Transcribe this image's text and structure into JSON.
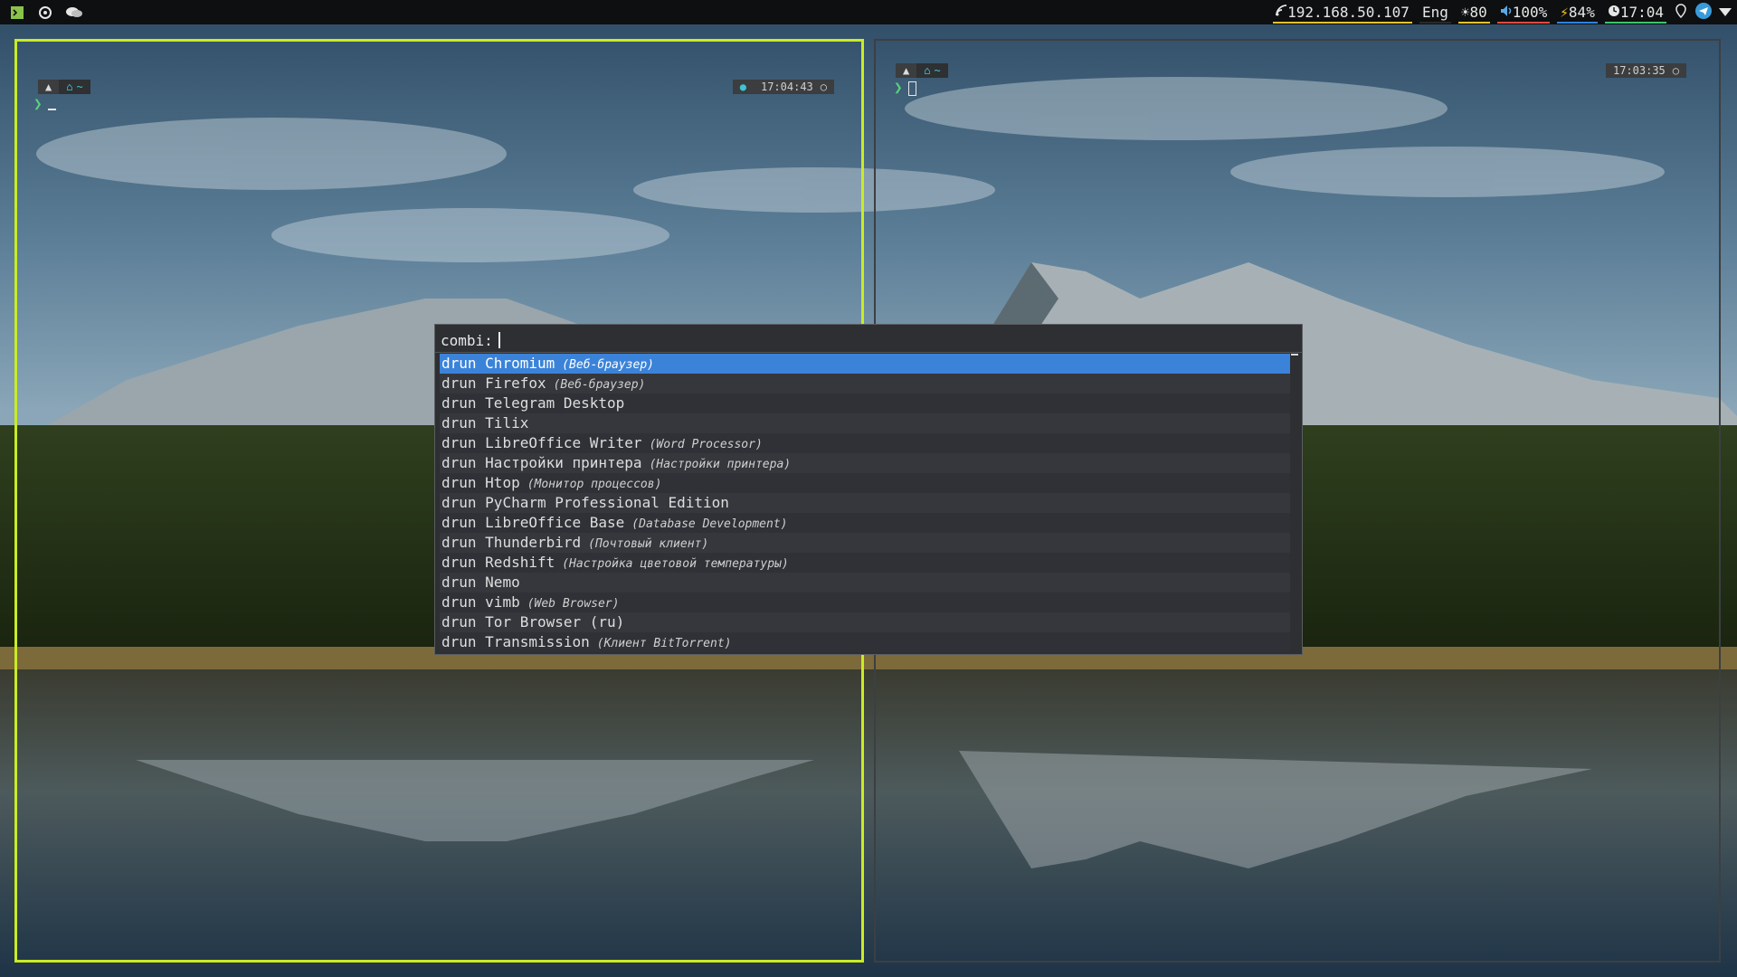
{
  "topbar": {
    "left_icons": [
      "terminal-icon",
      "settings-icon",
      "chat-icon"
    ],
    "network": {
      "icon": "network-icon",
      "text": "192.168.50.107",
      "accent": "#e8c22a"
    },
    "layout": {
      "text": "Eng",
      "accent": "#2a2a2a"
    },
    "brightness": {
      "icon": "brightness-icon",
      "text": "☀80",
      "accent": "#e8c22a"
    },
    "volume": {
      "icon": "volume-icon",
      "text": "100%",
      "accent": "#e24a3f"
    },
    "battery": {
      "icon": "battery-icon",
      "text": "84%",
      "accent": "#2f82e0"
    },
    "clock": {
      "icon": "clock-icon",
      "text": "17:04",
      "accent": "#3ec46b"
    },
    "tray_icons": [
      "location-icon",
      "telegram-icon",
      "wifi-icon"
    ]
  },
  "windows": {
    "left": {
      "prompt_home": "~",
      "prompt_glyph": "❯",
      "time": "17:04:43",
      "border_color": "#c9ec23"
    },
    "right": {
      "prompt_home": "~",
      "prompt_glyph": "❯",
      "time": "17:03:35",
      "border_color": "#3c3f42"
    }
  },
  "rofi": {
    "prompt": "combi:",
    "selected_index": 0,
    "entries": [
      {
        "mode": "drun",
        "name": "Chromium",
        "generic": "(Веб-браузер)"
      },
      {
        "mode": "drun",
        "name": "Firefox",
        "generic": "(Веб-браузер)"
      },
      {
        "mode": "drun",
        "name": "Telegram Desktop",
        "generic": ""
      },
      {
        "mode": "drun",
        "name": "Tilix",
        "generic": ""
      },
      {
        "mode": "drun",
        "name": "LibreOffice Writer",
        "generic": "(Word Processor)"
      },
      {
        "mode": "drun",
        "name": "Настройки принтера",
        "generic": "(Настройки принтера)"
      },
      {
        "mode": "drun",
        "name": "Htop",
        "generic": "(Монитор процессов)"
      },
      {
        "mode": "drun",
        "name": "PyCharm Professional Edition",
        "generic": ""
      },
      {
        "mode": "drun",
        "name": "LibreOffice Base",
        "generic": "(Database Development)"
      },
      {
        "mode": "drun",
        "name": "Thunderbird",
        "generic": "(Почтовый клиент)"
      },
      {
        "mode": "drun",
        "name": "Redshift",
        "generic": "(Настройка цветовой температуры)"
      },
      {
        "mode": "drun",
        "name": "Nemo",
        "generic": ""
      },
      {
        "mode": "drun",
        "name": "vimb",
        "generic": "(Web Browser)"
      },
      {
        "mode": "drun",
        "name": "Tor Browser (ru)",
        "generic": ""
      },
      {
        "mode": "drun",
        "name": "Transmission",
        "generic": "(Клиент BitTorrent)"
      }
    ]
  }
}
